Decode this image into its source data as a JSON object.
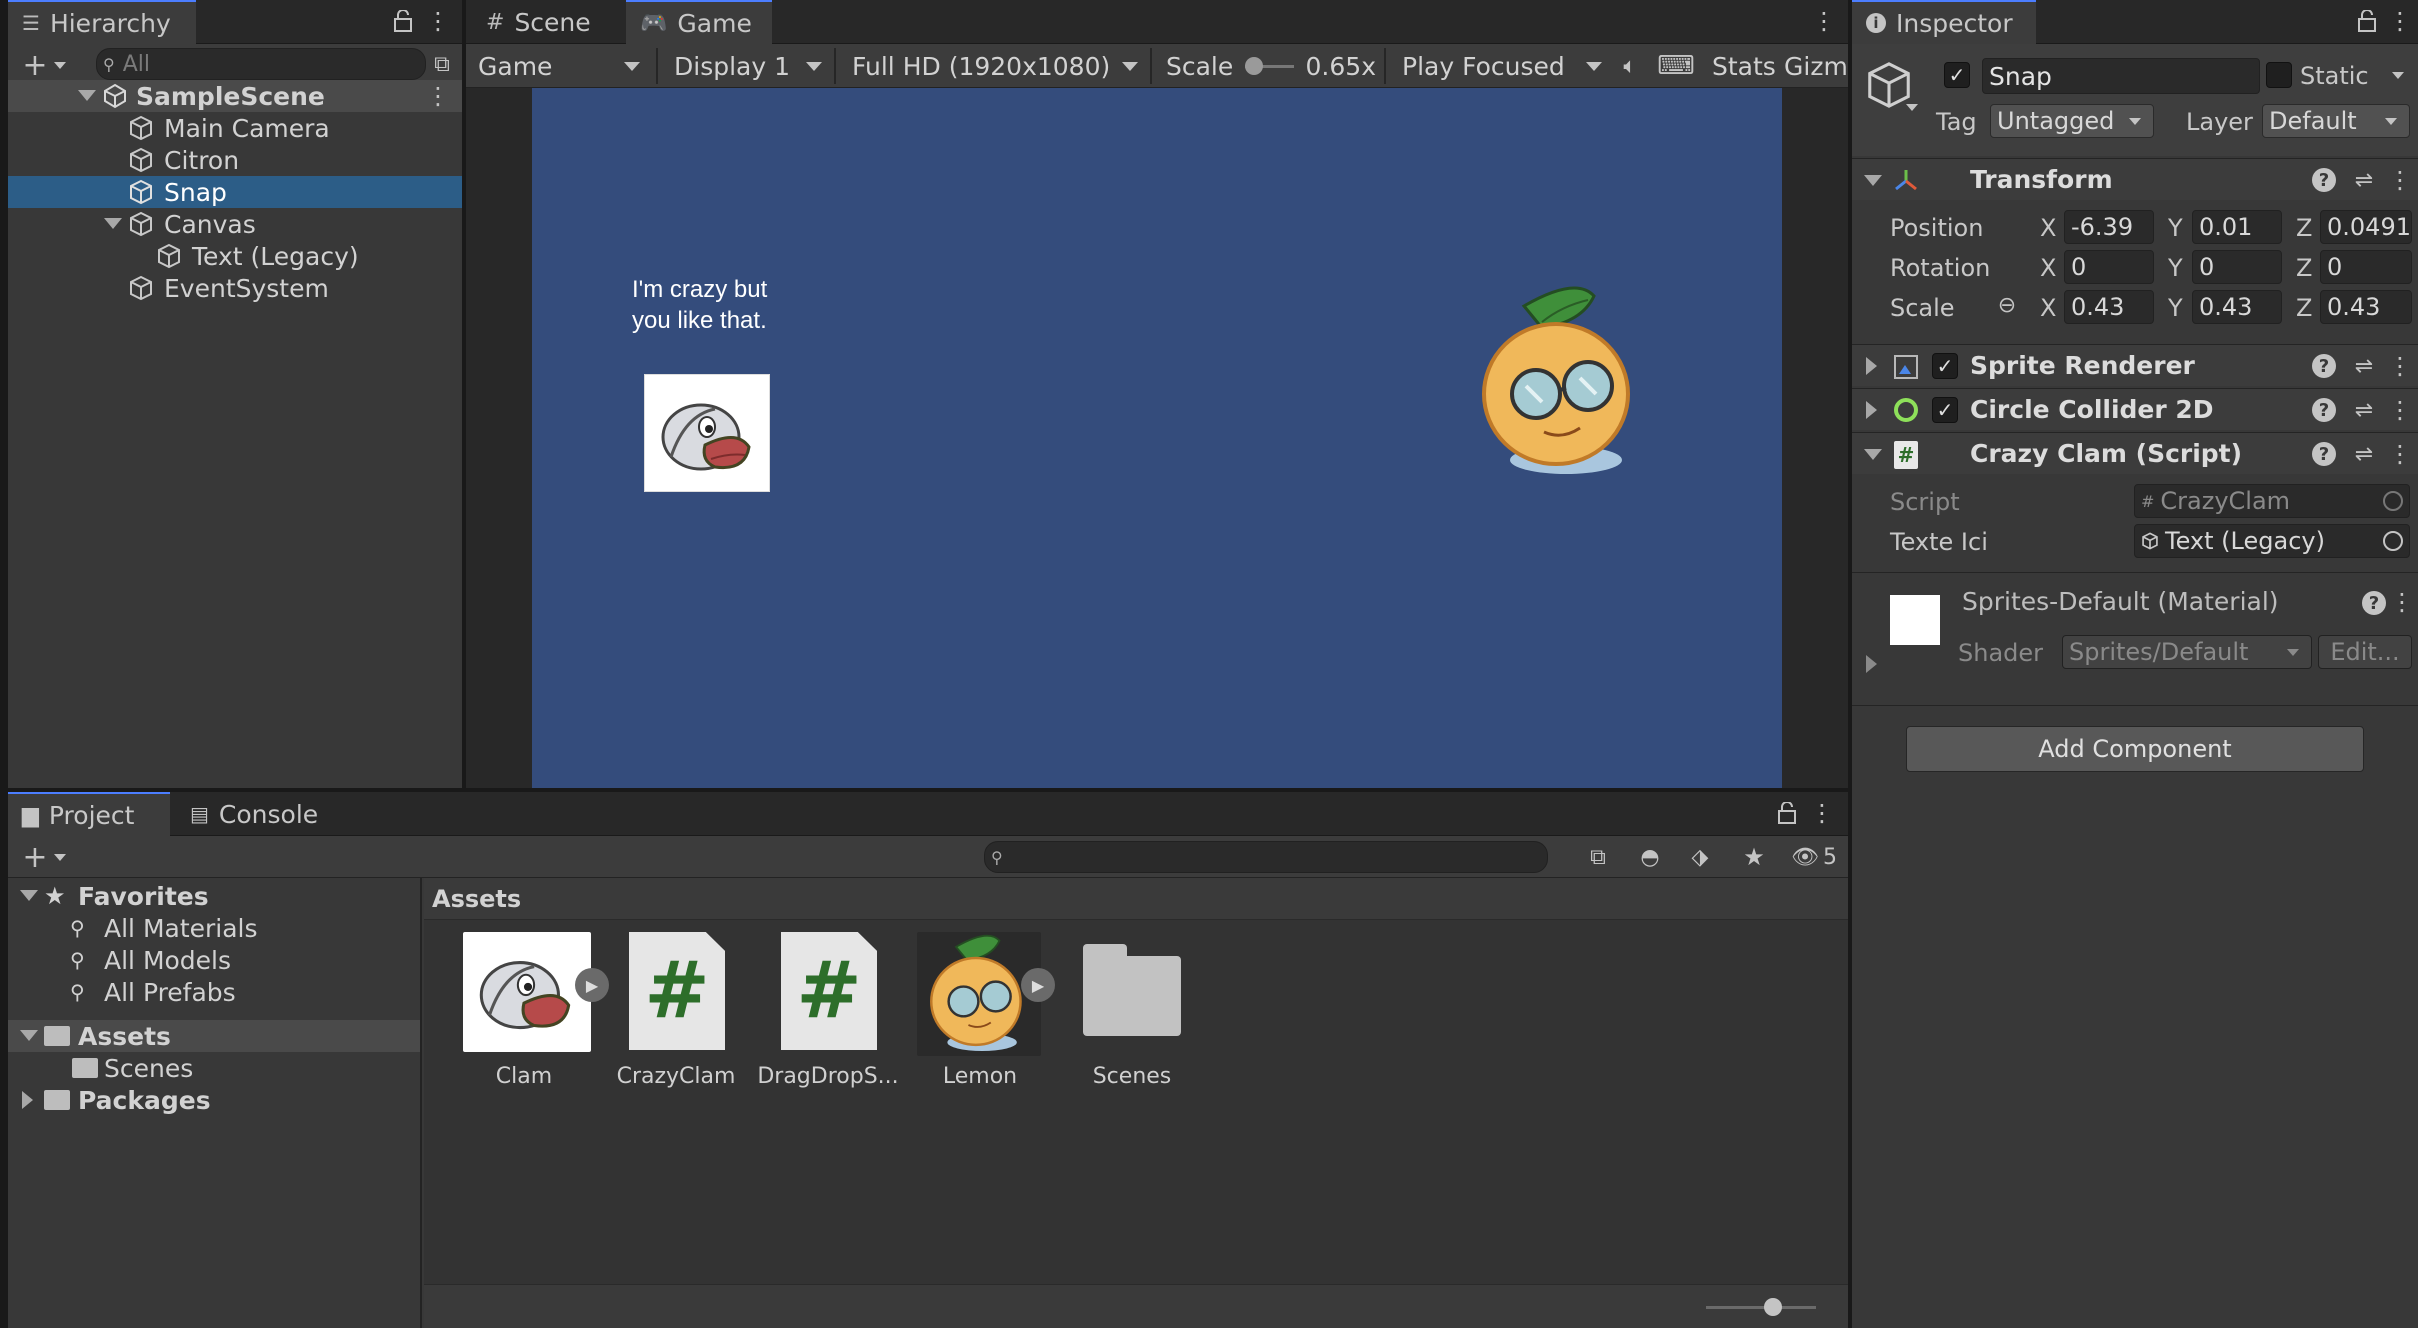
{
  "hierarchy": {
    "tab_label": "Hierarchy",
    "search_placeholder": "All",
    "scene_name": "SampleScene",
    "items": [
      {
        "label": "Main Camera"
      },
      {
        "label": "Citron"
      },
      {
        "label": "Snap"
      },
      {
        "label": "Canvas"
      },
      {
        "label": "Text (Legacy)"
      },
      {
        "label": "EventSystem"
      }
    ]
  },
  "game_view": {
    "tabs": [
      {
        "label": "Scene"
      },
      {
        "label": "Game"
      }
    ],
    "toolbar": {
      "view_mode": "Game",
      "display": "Display 1",
      "resolution": "Full HD (1920x1080)",
      "scale_label": "Scale",
      "scale_value": "0.65x",
      "play_mode": "Play Focused",
      "stats_label": "Stats",
      "gizmos_label": "Gizm"
    },
    "background_color": "#344c7c",
    "ui_text": "I'm crazy but\nyou like that."
  },
  "inspector": {
    "tab_label": "Inspector",
    "object_name": "Snap",
    "static_label": "Static",
    "tag_label": "Tag",
    "tag_value": "Untagged",
    "layer_label": "Layer",
    "layer_value": "Default",
    "transform": {
      "title": "Transform",
      "position_label": "Position",
      "rotation_label": "Rotation",
      "scale_label": "Scale",
      "position": {
        "x": "-6.39",
        "y": "0.01",
        "z": "0.0491"
      },
      "rotation": {
        "x": "0",
        "y": "0",
        "z": "0"
      },
      "scale": {
        "x": "0.43",
        "y": "0.43",
        "z": "0.43"
      },
      "axis_x": "X",
      "axis_y": "Y",
      "axis_z": "Z"
    },
    "sprite_renderer": {
      "title": "Sprite Renderer"
    },
    "circle_collider": {
      "title": "Circle Collider 2D"
    },
    "crazy_clam": {
      "title": "Crazy Clam (Script)",
      "script_label": "Script",
      "script_value": "CrazyClam",
      "texte_label": "Texte Ici",
      "texte_value": "Text (Legacy)"
    },
    "material": {
      "title": "Sprites-Default (Material)",
      "shader_label": "Shader",
      "shader_value": "Sprites/Default",
      "edit_label": "Edit..."
    },
    "add_component_label": "Add Component"
  },
  "project": {
    "tabs": [
      {
        "label": "Project"
      },
      {
        "label": "Console"
      }
    ],
    "hidden_count": "5",
    "favorites": {
      "label": "Favorites",
      "items": [
        {
          "label": "All Materials"
        },
        {
          "label": "All Models"
        },
        {
          "label": "All Prefabs"
        }
      ]
    },
    "assets_label": "Assets",
    "scenes_label": "Scenes",
    "packages_label": "Packages",
    "breadcrumb": "Assets",
    "assets": [
      {
        "label": "Clam"
      },
      {
        "label": "CrazyClam"
      },
      {
        "label": "DragDropS..."
      },
      {
        "label": "Lemon"
      },
      {
        "label": "Scenes"
      }
    ]
  },
  "colors": {
    "selection": "#2c5d87",
    "accent": "#4c7eff",
    "script_icon": "#2d6e2a"
  }
}
